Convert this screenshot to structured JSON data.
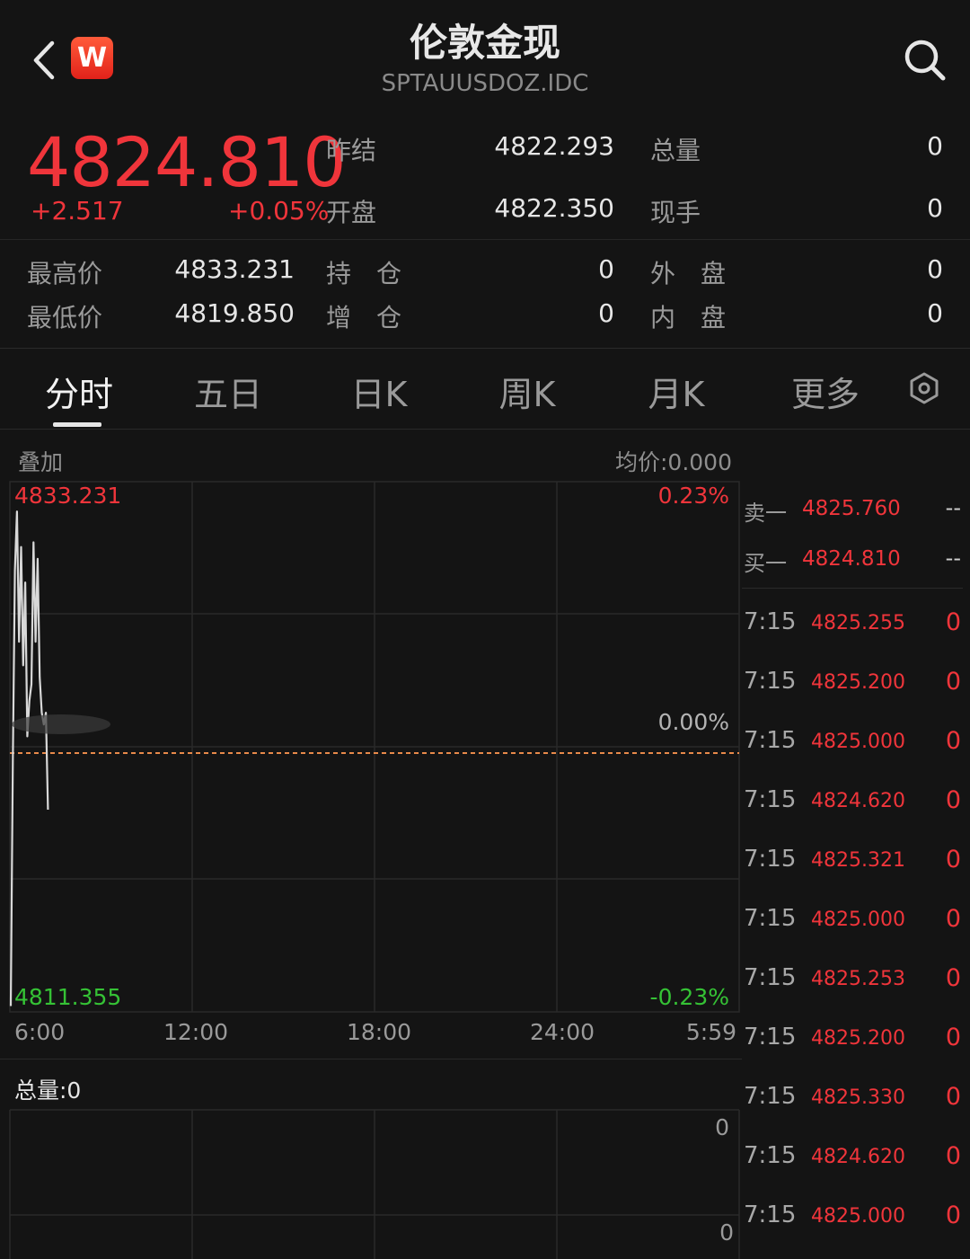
{
  "header": {
    "title": "伦敦金现",
    "subtitle": "SPTAUUSDOZ.IDC",
    "logo_letter": "W"
  },
  "quote": {
    "price": "4824.810",
    "change": "+2.517",
    "change_pct": "+0.05%",
    "fields": [
      {
        "label": "昨结",
        "value": "4822.293"
      },
      {
        "label": "开盘",
        "value": "4822.350"
      },
      {
        "label": "总量",
        "value": "0"
      },
      {
        "label": "现手",
        "value": "0"
      },
      {
        "label": "最高价",
        "value": "4833.231"
      },
      {
        "label": "最低价",
        "value": "4819.850"
      },
      {
        "label": "持　仓",
        "value": "0"
      },
      {
        "label": "增　仓",
        "value": "0"
      },
      {
        "label": "外　盘",
        "value": "0"
      },
      {
        "label": "内　盘",
        "value": "0"
      }
    ]
  },
  "tabs": [
    "分时",
    "五日",
    "日K",
    "周K",
    "月K",
    "更多"
  ],
  "chart": {
    "overlay_label": "叠加",
    "avg_price": "均价:0.000",
    "y_max": "4833.231",
    "y_min": "4811.355",
    "pct_max": "0.23%",
    "pct_mid": "0.00%",
    "pct_min": "-0.23%",
    "x_ticks": [
      "6:00",
      "12:00",
      "18:00",
      "24:00",
      "5:59"
    ],
    "volume_label": "总量:0",
    "volume_top": "0",
    "volume_bottom": "0"
  },
  "chart_data": {
    "type": "line",
    "xlabel": "",
    "ylabel": "",
    "x_ticks": [
      "6:00",
      "12:00",
      "18:00",
      "24:00",
      "5:59"
    ],
    "ylim": [
      4811.355,
      4833.231
    ],
    "reference_line": 4822.293,
    "series": [
      {
        "values": [
          4811.6,
          4822.0,
          4830.0,
          4832.5,
          4827.0,
          4831.0,
          4826.0,
          4829.5,
          4823.0,
          4824.5,
          4825.2,
          4831.2,
          4827.0,
          4830.5,
          4825.5,
          4824.0,
          4823.5,
          4824.0,
          4819.9
        ]
      }
    ]
  },
  "order_book": {
    "sell": {
      "label": "卖一",
      "price": "4825.760",
      "qty": "--"
    },
    "buy": {
      "label": "买一",
      "price": "4824.810",
      "qty": "--"
    }
  },
  "trades": [
    {
      "time": "7:15",
      "price": "4825.255",
      "vol": "0"
    },
    {
      "time": "7:15",
      "price": "4825.200",
      "vol": "0"
    },
    {
      "time": "7:15",
      "price": "4825.000",
      "vol": "0"
    },
    {
      "time": "7:15",
      "price": "4824.620",
      "vol": "0"
    },
    {
      "time": "7:15",
      "price": "4825.321",
      "vol": "0"
    },
    {
      "time": "7:15",
      "price": "4825.000",
      "vol": "0"
    },
    {
      "time": "7:15",
      "price": "4825.253",
      "vol": "0"
    },
    {
      "time": "7:15",
      "price": "4825.200",
      "vol": "0"
    },
    {
      "time": "7:15",
      "price": "4825.330",
      "vol": "0"
    },
    {
      "time": "7:15",
      "price": "4824.620",
      "vol": "0"
    },
    {
      "time": "7:15",
      "price": "4825.000",
      "vol": "0"
    }
  ]
}
